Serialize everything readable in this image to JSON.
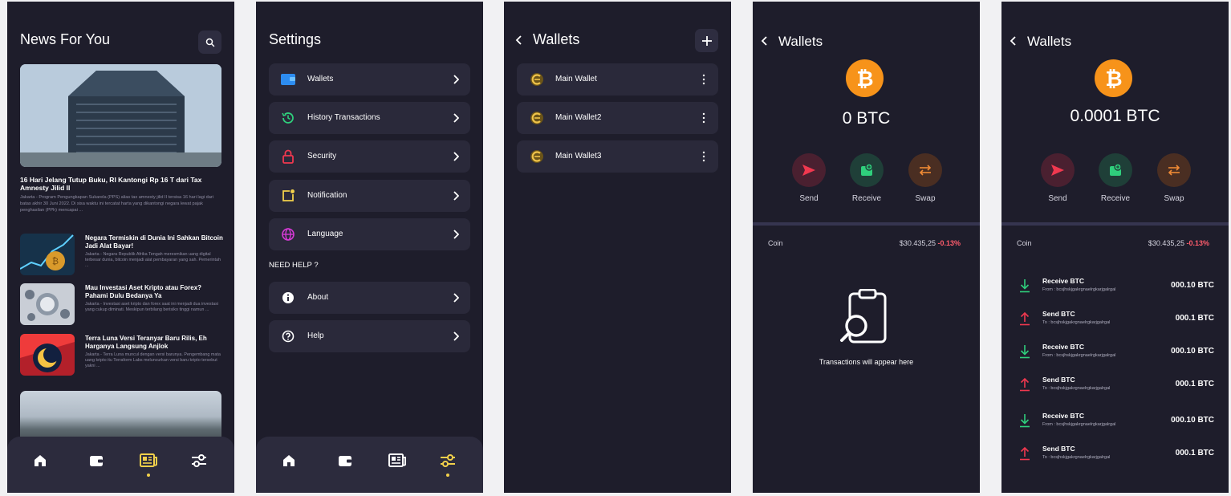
{
  "colors": {
    "background": "#1e1d2b",
    "card": "#2a293a",
    "accent_yellow": "#f2d04b",
    "bitcoin": "#f7931a",
    "negative": "#ff5c6c",
    "send": "#f0384f",
    "receive": "#2fcf7c",
    "swap": "#f08a35"
  },
  "news": {
    "title": "News For You",
    "headline": {
      "title": "16 Hari Jelang Tutup Buku, RI Kantongi Rp 16 T dari Tax Amnesty Jilid II",
      "desc": "Jakarta - Program Pengungkapan Sukarela (PPS) alias tax amnesty jilid II tersisa 16 hari lagi dari batas akhir 30 Juni 2022. Di sisa waktu ini tercatat harta yang dikantongi negara lewat pajak penghasilan (PPh) mencapai ..."
    },
    "items": [
      {
        "title": "Negara Termiskin di Dunia Ini Sahkan Bitcoin Jadi Alat Bayar!",
        "desc": "Jakarta - Negara Republik Afrika Tengah meresmikan uang digital terbesar dunia, bitcoin menjadi alat pembayaran yang sah. Pemerintah ..."
      },
      {
        "title": "Mau Investasi Aset Kripto atau Forex? Pahami Dulu Bedanya Ya",
        "desc": "Jakarta - Investasi aset kripto dan forex saat ini menjadi dua investasi yang cukup diminati. Meskipun terbilang berisiko tinggi namun ..."
      },
      {
        "title": "Terra Luna Versi Teranyar Baru Rilis, Eh Harganya Langsung Anjlok",
        "desc": "Jakarta - Terra Luna muncul dengan versi barunya. Pengembang mata uang kripto itu Terraform Labs meluncurkan versi baru kripto tersebut yakni ..."
      }
    ]
  },
  "settings": {
    "title": "Settings",
    "items": [
      {
        "label": "Wallets",
        "icon": "wallet-icon"
      },
      {
        "label": "History Transactions",
        "icon": "history-icon"
      },
      {
        "label": "Security",
        "icon": "lock-icon"
      },
      {
        "label": "Notification",
        "icon": "notification-icon"
      },
      {
        "label": "Language",
        "icon": "globe-icon"
      }
    ],
    "help_section": "NEED HELP ?",
    "help_items": [
      {
        "label": "About",
        "icon": "info-icon"
      },
      {
        "label": "Help",
        "icon": "help-icon"
      }
    ]
  },
  "wallets": {
    "title": "Wallets",
    "items": [
      "Main Wallet",
      "Main Wallet2",
      "Main Wallet3"
    ]
  },
  "wallet_empty": {
    "title": "Wallets",
    "balance": "0 BTC",
    "actions": [
      "Send",
      "Receive",
      "Swap"
    ],
    "coin_label": "Coin",
    "coin_price": "$30.435,25",
    "coin_change": "-0.13%",
    "empty_text": "Transactions will appear here"
  },
  "wallet_tx": {
    "title": "Wallets",
    "balance": "0.0001 BTC",
    "actions": [
      "Send",
      "Receive",
      "Swap"
    ],
    "coin_label": "Coin",
    "coin_price": "$30.435,25",
    "coin_change": "-0.13%",
    "transactions": [
      {
        "type": "Receive  BTC",
        "addr": "From  : bcsjhskjgakrgnaelrgkarjgalrgal",
        "amount": "000.10 BTC",
        "dir": "in"
      },
      {
        "type": "Send  BTC",
        "addr": "To  : bcsjhskjgakrgnaelrgkarjgalrgal",
        "amount": "000.1 BTC",
        "dir": "out"
      },
      {
        "type": "Receive  BTC",
        "addr": "From  : bcsjhskjgakrgnaelrgkarjgalrgal",
        "amount": "000.10 BTC",
        "dir": "in"
      },
      {
        "type": "Send  BTC",
        "addr": "To  : bcsjhskjgakrgnaelrgkarjgalrgal",
        "amount": "000.1 BTC",
        "dir": "out"
      },
      {
        "type": "Receive  BTC",
        "addr": "From  : bcsjhskjgakrgnaelrgkarjgalrgal",
        "amount": "000.10 BTC",
        "dir": "in"
      },
      {
        "type": "Send  BTC",
        "addr": "To  : bcsjhskjgakrgnaelrgkarjgalrgal",
        "amount": "000.1 BTC",
        "dir": "out"
      }
    ]
  }
}
